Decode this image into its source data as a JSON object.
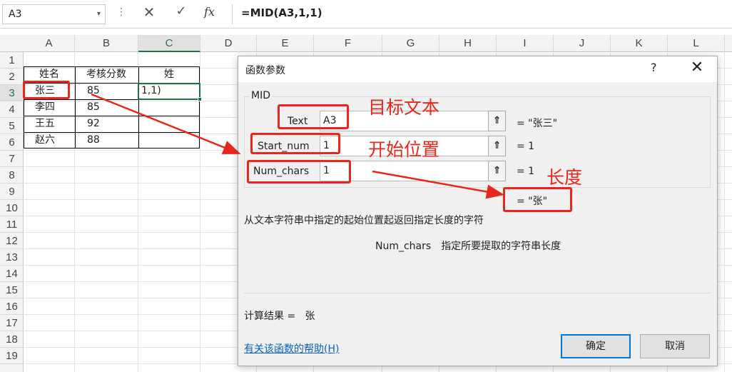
{
  "formula_bar": {
    "name_box": "A3",
    "name_box_arrow": "▾",
    "dots": "⋮",
    "cancel_icon": "✕",
    "enter_icon": "✓",
    "fx_label": "fx",
    "formula": "=MID(A3,1,1)"
  },
  "grid": {
    "columns": [
      "A",
      "B",
      "C",
      "D",
      "E",
      "F",
      "G",
      "H",
      "I",
      "J",
      "K",
      "L"
    ],
    "active_column": "C",
    "rows": [
      "1",
      "2",
      "3",
      "4",
      "5",
      "6",
      "7",
      "8",
      "9",
      "10",
      "11",
      "12",
      "13",
      "14",
      "15",
      "16",
      "17",
      "18",
      "19"
    ],
    "active_row": "3"
  },
  "table": {
    "headers": [
      "姓名",
      "考核分数",
      "姓"
    ],
    "rows": [
      {
        "name": "张三",
        "score": "85",
        "surname": "1,1)"
      },
      {
        "name": "李四",
        "score": "85",
        "surname": ""
      },
      {
        "name": "王五",
        "score": "92",
        "surname": ""
      },
      {
        "name": "赵六",
        "score": "88",
        "surname": ""
      }
    ]
  },
  "annotations": {
    "text_label": "目标文本",
    "start_label": "开始位置",
    "length_label": "长度",
    "color": "#e8261c"
  },
  "dialog": {
    "title": "函数参数",
    "help": "?",
    "close": "✕",
    "function_name": "MID",
    "args": [
      {
        "label": "Text",
        "value": "A3",
        "result": "=   \"张三\""
      },
      {
        "label": "Start_num",
        "value": "1",
        "result": "=   1"
      },
      {
        "label": "Num_chars",
        "value": "1",
        "result": "=   1"
      }
    ],
    "ref_icon": "⇑",
    "result": "=   \"张\"",
    "description": "从文本字符串中指定的起始位置起返回指定长度的字符",
    "arg_desc_name": "Num_chars",
    "arg_desc_text": "指定所要提取的字符串长度",
    "calc_label": "计算结果 =",
    "calc_value": "张",
    "help_link": "有关该函数的帮助(H)",
    "ok": "确定",
    "cancel": "取消"
  }
}
